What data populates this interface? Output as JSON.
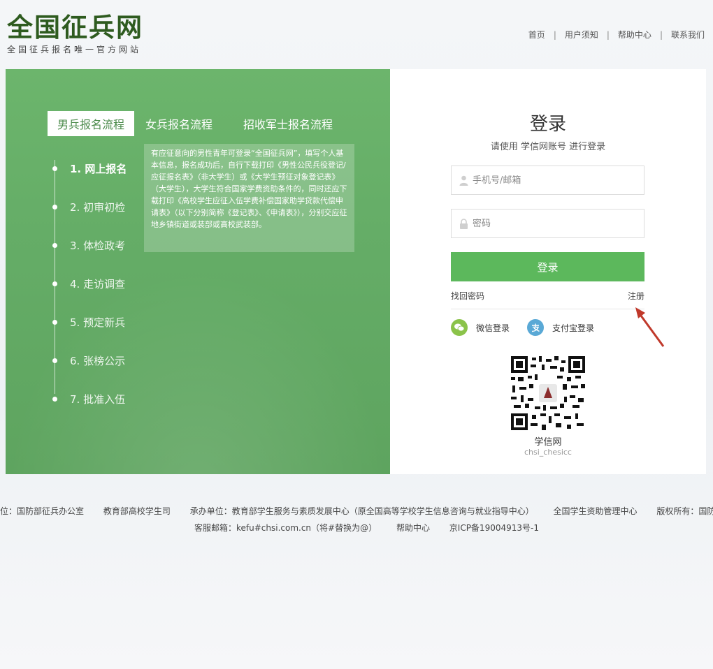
{
  "header": {
    "logo_title": "全国征兵网",
    "logo_subtitle": "全国征兵报名唯一官方网站",
    "nav": [
      "首页",
      "用户须知",
      "帮助中心",
      "联系我们"
    ]
  },
  "process": {
    "tabs": [
      "男兵报名流程",
      "女兵报名流程",
      "招收军士报名流程"
    ],
    "active_tab": 0,
    "steps": [
      "1. 网上报名",
      "2. 初审初检",
      "3. 体检政考",
      "4. 走访调查",
      "5. 预定新兵",
      "6. 张榜公示",
      "7. 批准入伍"
    ],
    "active_step": 0,
    "info": "有应征意向的男性青年可登录“全国征兵网”，填写个人基本信息，报名成功后，自行下载打印《男性公民兵役登记/应征报名表》（非大学生）或《大学生预征对象登记表》（大学生），大学生符合国家学费资助条件的，同时还应下载打印《高校学生应征入伍学费补偿国家助学贷款代偿申请表》（以下分别简称《登记表》、《申请表》），分别交应征地乡镇街道或装部或高校武装部。"
  },
  "login": {
    "title": "登录",
    "subtitle": "请使用 学信网账号 进行登录",
    "username_placeholder": "手机号/邮箱",
    "password_placeholder": "密码",
    "submit_label": "登录",
    "forgot_label": "找回密码",
    "register_label": "注册",
    "wechat_label": "微信登录",
    "alipay_label": "支付宝登录",
    "qr_name": "学信网",
    "qr_id": "chsi_chesicc"
  },
  "footer": {
    "line1": [
      "位：国防部征兵办公室",
      "教育部高校学生司",
      "承办单位：教育部学生服务与素质发展中心（原全国高等学校学生信息咨询与就业指导中心）",
      "全国学生资助管理中心",
      "版权所有：国防部征兵"
    ],
    "line2": [
      "客服邮箱：kefu#chsi.com.cn（将#替换为@）",
      "帮助中心",
      "京ICP备19004913号-1"
    ]
  },
  "colors": {
    "brand_green": "#5cb85c",
    "panel_green": "#65ad67",
    "logo_green": "#2e5b1f",
    "arrow_red": "#c0392b"
  }
}
